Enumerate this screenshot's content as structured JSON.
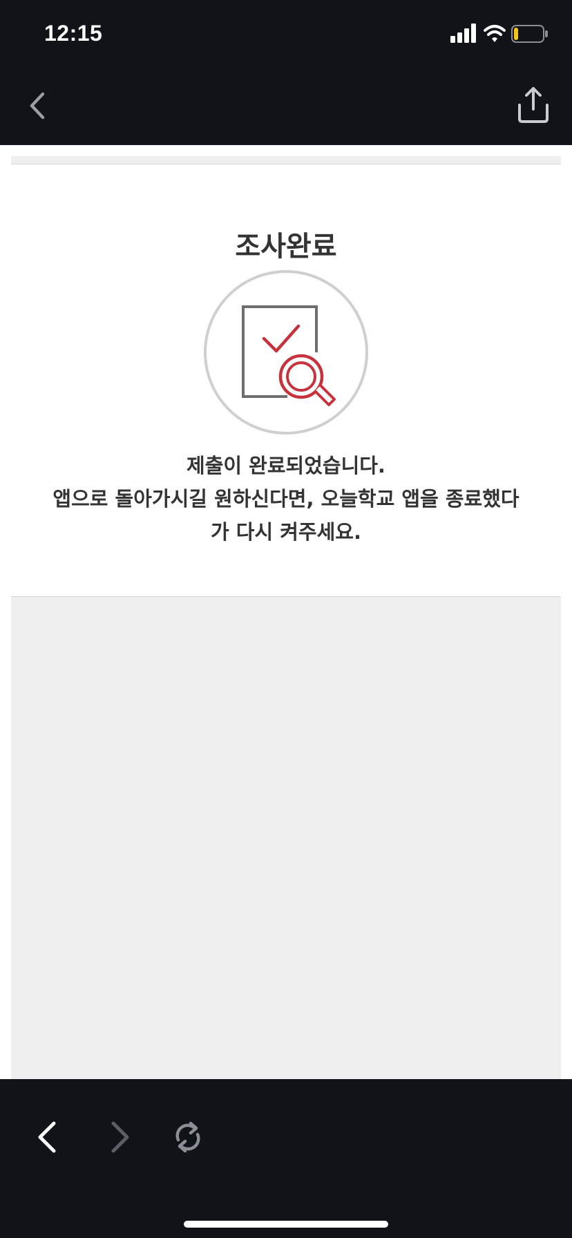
{
  "status_bar": {
    "time": "12:15",
    "battery_level": 0.15,
    "battery_color": "#f5c518"
  },
  "top_nav": {
    "back_icon": "chevron-left-icon",
    "share_icon": "share-upload-icon"
  },
  "completion": {
    "title": "조사완료",
    "illustration_icon": "document-check-magnifier-icon",
    "message_lines": [
      "제출이 완료되었습니다.",
      "앱으로 돌아가시길 원하신다면, 오늘학교 앱을 종료했다",
      "가 다시 켜주세요."
    ]
  },
  "bottom_toolbar": {
    "back_icon": "chevron-left-icon",
    "forward_icon": "chevron-right-icon",
    "refresh_icon": "refresh-icon"
  },
  "colors": {
    "chrome_background": "#101317",
    "accent_red": "#c8323c",
    "content_gray": "#efefef"
  }
}
